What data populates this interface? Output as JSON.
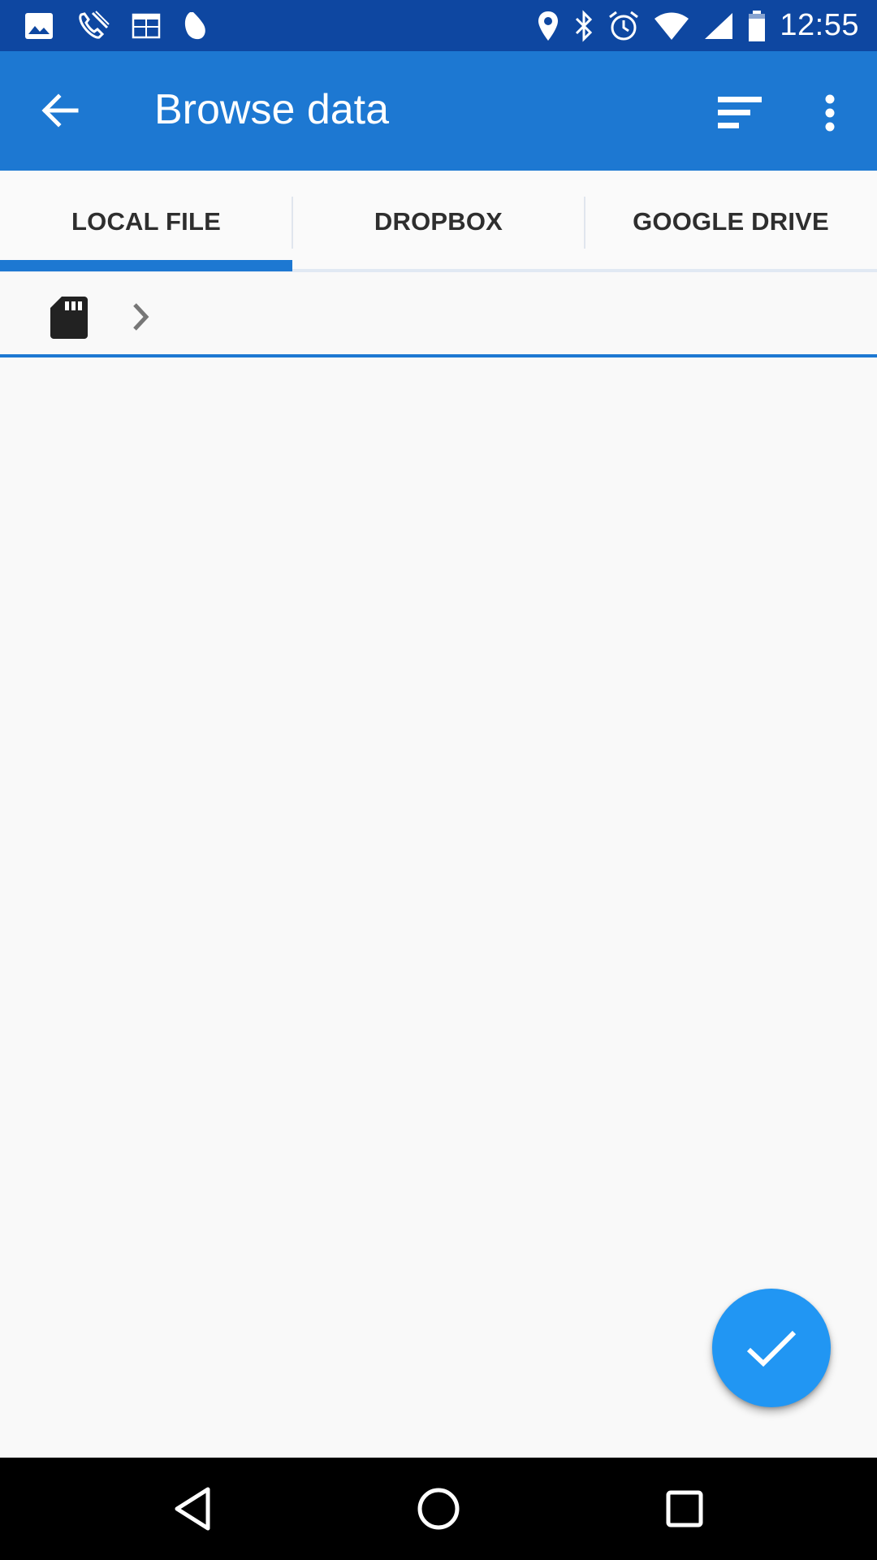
{
  "status_bar": {
    "time": "12:55",
    "left_icons": [
      "image-icon",
      "phone-icon",
      "calendar-icon",
      "leaf-icon"
    ],
    "right_icons": [
      "location-icon",
      "bluetooth-icon",
      "alarm-icon",
      "wifi-icon",
      "signal-icon",
      "battery-icon"
    ]
  },
  "app_bar": {
    "title": "Browse data",
    "back_icon": "arrow-back-icon",
    "sort_icon": "sort-icon",
    "more_icon": "more-vert-icon"
  },
  "tabs": [
    {
      "label": "LOCAL FILE",
      "selected": true
    },
    {
      "label": "DROPBOX",
      "selected": false
    },
    {
      "label": "GOOGLE DRIVE",
      "selected": false
    }
  ],
  "path_bar": {
    "root_icon": "sd-card-icon",
    "separator_icon": "chevron-right-icon"
  },
  "fab": {
    "icon": "check-icon"
  },
  "nav_bar": {
    "icons": [
      "nav-back-icon",
      "nav-home-icon",
      "nav-recents-icon"
    ]
  },
  "colors": {
    "status_bar": "#0e47a1",
    "primary": "#1d78d2",
    "fab": "#2196f3",
    "background": "#f9f9f9"
  }
}
